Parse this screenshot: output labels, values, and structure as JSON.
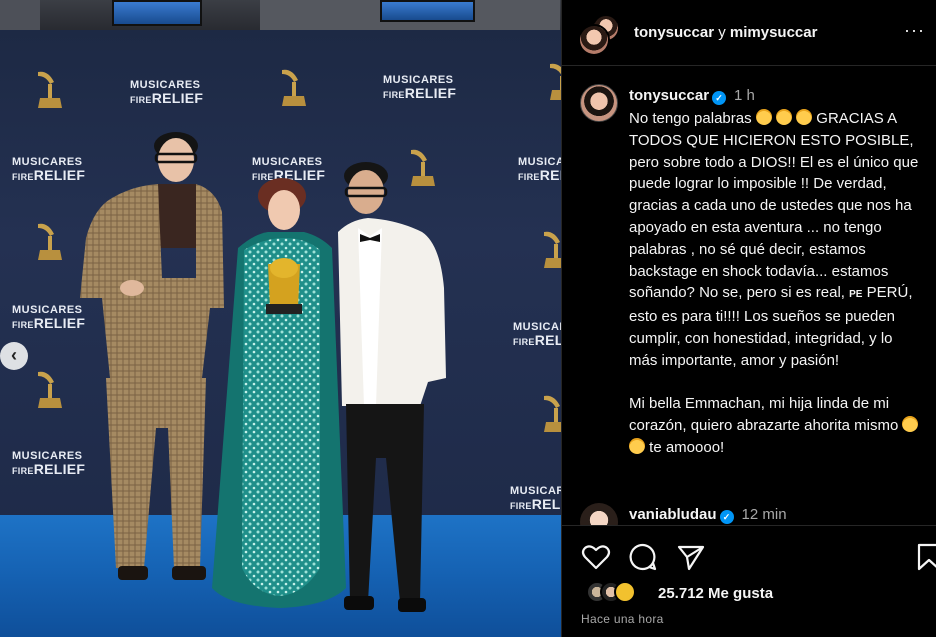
{
  "photo": {
    "brand_line1": "MUSICARES",
    "brand_line2_a": "FIRE",
    "brand_line2_b": "RELIEF",
    "prev_arrow": "‹"
  },
  "header": {
    "user1": "tonysuccar",
    "conj": "y",
    "user2": "mimysuccar",
    "more": "···"
  },
  "caption": {
    "username": "tonysuccar",
    "time": "1 h",
    "line1a": "No tengo palabras ",
    "line1b": " GRACIAS A TODOS QUE HICIERON ESTO POSIBLE, pero sobre todo a DIOS!! El es el único que puede lograr lo imposible !! De verdad, gracias a cada uno de ustedes que nos ha apoyado en esta aventura ... no tengo palabras , no sé qué decir, estamos backstage en shock todavía... estamos soñando? No se, pero si es real, ",
    "flag_text": "PE",
    "line1c": " PERÚ, esto es para ti!!!! Los sueños se pueden cumplir, con honestidad, integridad, y lo más importante, amor y pasión!",
    "para2a": "Mi bella Emmachan, mi hija linda de mi corazón, quiero abrazarte ahorita mismo ",
    "para2b": " te amoooo!"
  },
  "comment": {
    "username": "vaniabludau",
    "time": "12 min"
  },
  "footer": {
    "likes": "25.712 Me gusta",
    "ago": "Hace una hora"
  }
}
